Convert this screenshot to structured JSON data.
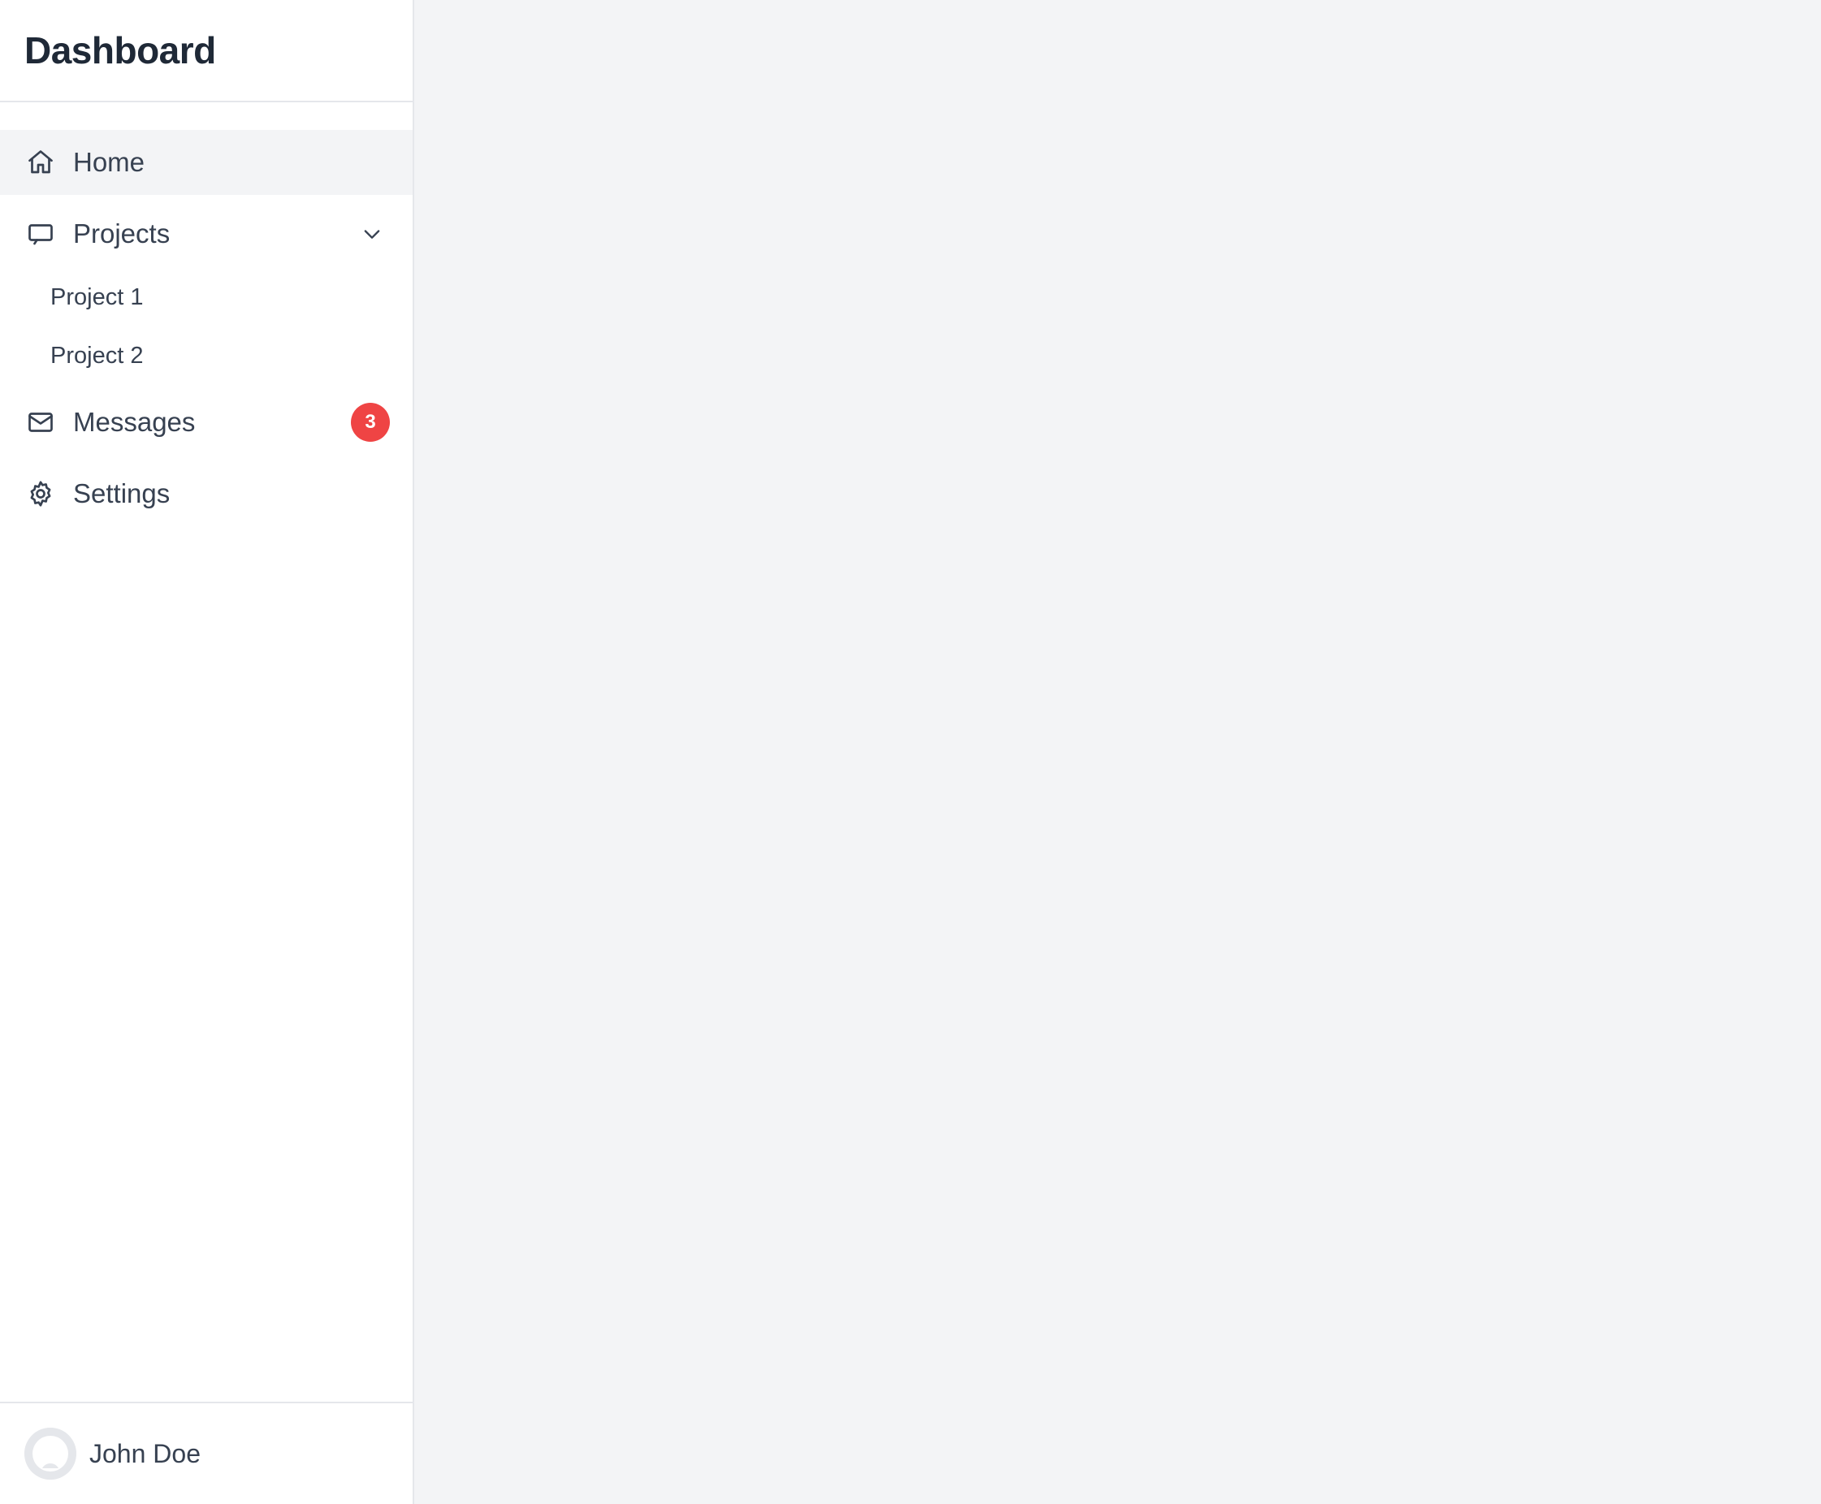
{
  "sidebar": {
    "title": "Dashboard",
    "nav": {
      "home": {
        "label": "Home",
        "icon": "home-icon",
        "active": true
      },
      "projects": {
        "label": "Projects",
        "icon": "monitor-icon",
        "expanded": true,
        "children": [
          {
            "label": "Project 1"
          },
          {
            "label": "Project 2"
          }
        ]
      },
      "messages": {
        "label": "Messages",
        "icon": "mail-icon",
        "badge": "3"
      },
      "settings": {
        "label": "Settings",
        "icon": "gear-icon"
      }
    },
    "user": {
      "name": "John Doe",
      "avatar": "avatar-placeholder"
    }
  },
  "colors": {
    "badge": "#ef4444",
    "active_bg": "#f3f4f6",
    "main_bg": "#f3f4f6",
    "text": "#374151",
    "title": "#1f2937"
  }
}
